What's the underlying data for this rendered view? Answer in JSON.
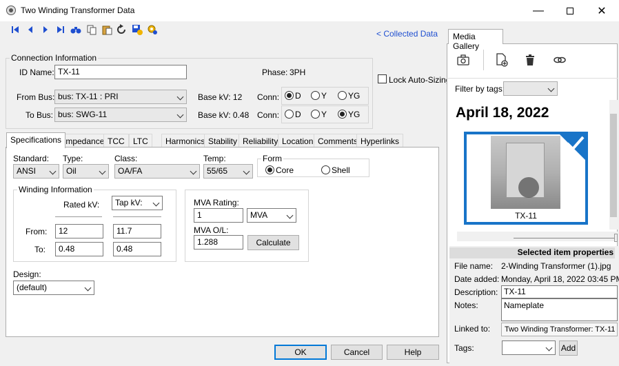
{
  "window": {
    "title": "Two Winding Transformer Data"
  },
  "toolbar": {
    "collected_link": "< Collected Data"
  },
  "connection": {
    "legend": "Connection Information",
    "id_label": "ID Name:",
    "id_value": "TX-11",
    "phase_label": "Phase:",
    "phase_value": "3PH",
    "lock_label": "Lock Auto-Sizing",
    "from_bus_label": "From Bus:",
    "from_bus_value": "bus: TX-11 : PRI",
    "from_basekv": "Base kV: 12",
    "to_bus_label": "To Bus:",
    "to_bus_value": "bus: SWG-11",
    "to_basekv": "Base kV: 0.48",
    "conn_label": "Conn:",
    "conn_options": [
      "D",
      "Y",
      "YG"
    ],
    "from_conn_selected": "D",
    "to_conn_selected": "YG"
  },
  "tabs": [
    "Specifications",
    "Impedance",
    "TCC",
    "LTC",
    "Harmonics",
    "Stability",
    "Reliability",
    "Location",
    "Comments",
    "Hyperlinks"
  ],
  "spec": {
    "standard_label": "Standard:",
    "standard_value": "ANSI",
    "type_label": "Type:",
    "type_value": "Oil",
    "class_label": "Class:",
    "class_value": "OA/FA",
    "temp_label": "Temp:",
    "temp_value": "55/65",
    "form_legend": "Form",
    "form_core": "Core",
    "form_shell": "Shell",
    "winding_legend": "Winding Information",
    "rated_kv": "Rated kV:",
    "tap_kv": "Tap kV:",
    "from_label": "From:",
    "to_label": "To:",
    "from_rated": "12",
    "from_tap": "11.7",
    "to_rated": "0.48",
    "to_tap": "0.48",
    "mva_rating_label": "MVA Rating:",
    "mva_rating_value": "1",
    "mva_unit": "MVA",
    "mva_ol_label": "MVA O/L:",
    "mva_ol_value": "1.288",
    "calculate": "Calculate",
    "design_label": "Design:",
    "design_value": "(default)"
  },
  "buttons": {
    "ok": "OK",
    "cancel": "Cancel",
    "help": "Help"
  },
  "gallery": {
    "tab": "Media Gallery",
    "filter_label": "Filter by tags:",
    "date_heading": "April 18, 2022",
    "thumb_caption": "TX-11",
    "props_header": "Selected item properties",
    "file_name_label": "File name:",
    "file_name": "2-Winding Transformer (1).jpg",
    "date_added_label": "Date added:",
    "date_added": "Monday, April 18, 2022 03:45 PM",
    "description_label": "Description:",
    "description": "TX-11",
    "notes_label": "Notes:",
    "notes": "Nameplate",
    "linked_label": "Linked to:",
    "linked": "Two Winding Transformer: TX-11",
    "tags_label": "Tags:",
    "add": "Add"
  },
  "colors": {
    "accent": "#1f4fd0",
    "selection": "#1874c8"
  }
}
